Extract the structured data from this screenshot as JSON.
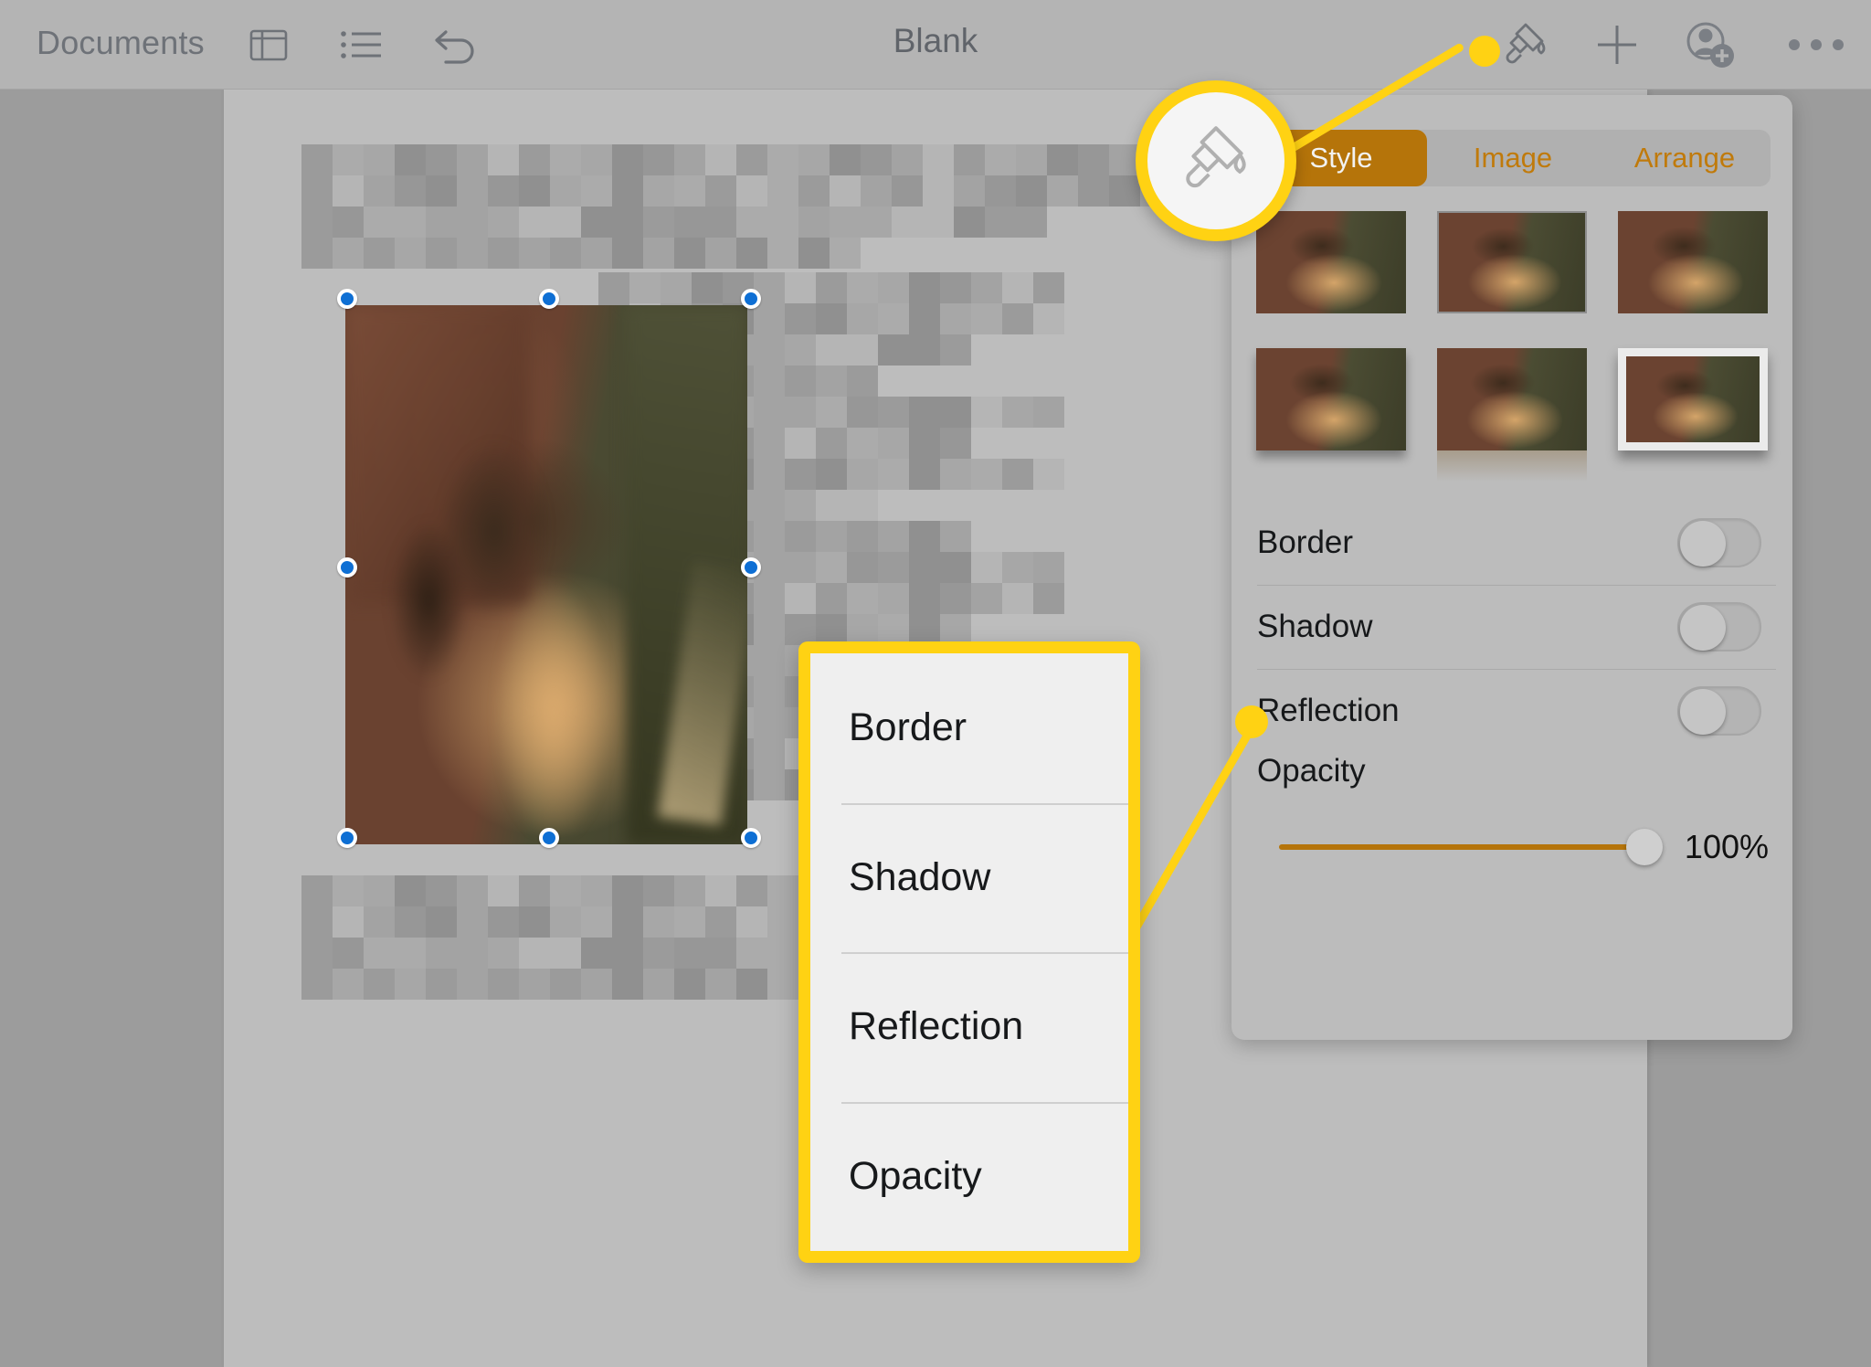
{
  "toolbar": {
    "documents_label": "Documents",
    "title": "Blank",
    "icons": [
      {
        "name": "sidebar-layout-icon"
      },
      {
        "name": "bulleted-list-icon"
      },
      {
        "name": "undo-icon"
      },
      {
        "name": "paintbrush-format-icon"
      },
      {
        "name": "plus-insert-icon"
      },
      {
        "name": "add-collaborator-icon"
      },
      {
        "name": "more-ellipsis-icon"
      }
    ]
  },
  "format_panel": {
    "tabs": [
      {
        "label": "Style",
        "selected": true
      },
      {
        "label": "Image",
        "selected": false
      },
      {
        "label": "Arrange",
        "selected": false
      }
    ],
    "style_presets_count": 6,
    "style_presets": [
      {
        "name": "plain",
        "selected": false
      },
      {
        "name": "thin-border",
        "selected": true
      },
      {
        "name": "soft-shadow",
        "selected": false
      },
      {
        "name": "drop-shadow",
        "selected": false
      },
      {
        "name": "reflection",
        "selected": false
      },
      {
        "name": "thick-white-frame",
        "selected": false
      }
    ],
    "rows": [
      {
        "label": "Border",
        "toggle": "off"
      },
      {
        "label": "Shadow",
        "toggle": "off"
      },
      {
        "label": "Reflection",
        "toggle": "off"
      }
    ],
    "opacity": {
      "label": "Opacity",
      "value_text": "100%",
      "value": 100,
      "min": 0,
      "max": 100
    }
  },
  "callout": {
    "items": [
      {
        "label": "Border"
      },
      {
        "label": "Shadow"
      },
      {
        "label": "Reflection"
      },
      {
        "label": "Opacity"
      }
    ]
  },
  "magnifier": {
    "icon": "paintbrush-format-icon"
  },
  "selection": {
    "handles": 8,
    "handle_color": "#0e6fd4",
    "image_alt": "photo-of-dog-on-leather-couch"
  },
  "colors": {
    "accent_orange": "#c07a0b",
    "accent_orange_active": "#b5740a",
    "annotation_yellow": "#ffd213",
    "toolbar_gray": "#b4b4b4",
    "panel_gray": "#bcbcbc",
    "page_gray": "#bdbdbd",
    "canvas_gray": "#9c9c9c",
    "selection_blue": "#0e6fd4"
  }
}
